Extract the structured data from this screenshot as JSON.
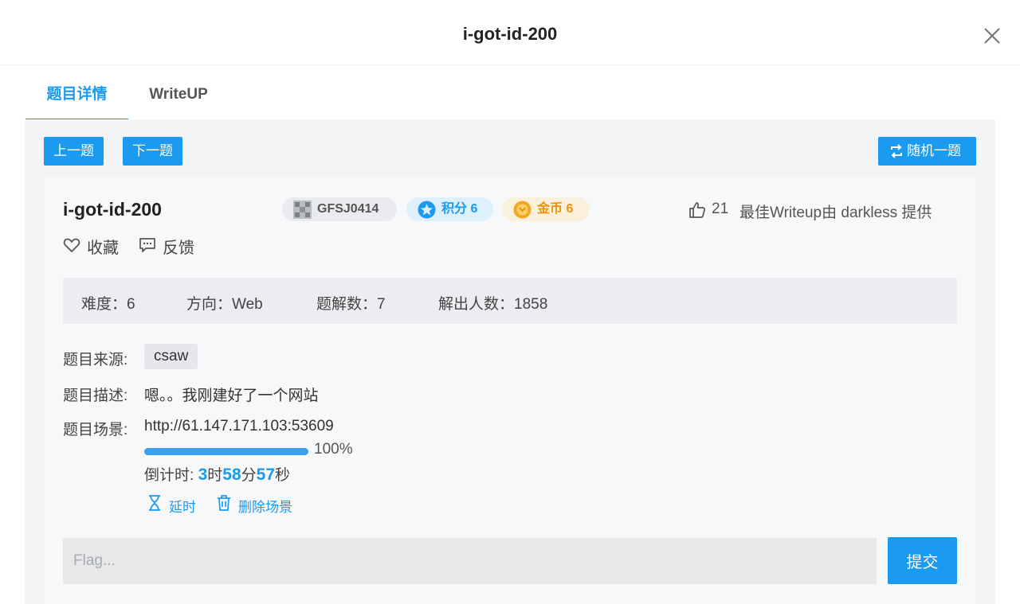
{
  "modal": {
    "title": "i-got-id-200"
  },
  "tabs": [
    {
      "label": "题目详情",
      "active": true
    },
    {
      "label": "WriteUP",
      "active": false
    }
  ],
  "toolbar": {
    "prev_label": "上一题",
    "next_label": "下一题",
    "random_label": "随机一题"
  },
  "challenge": {
    "name": "i-got-id-200",
    "author": "GFSJ0414",
    "score": "积分 6",
    "coins": "金币 6",
    "likes": "21",
    "best_writeup": "最佳Writeup由 darkless 提供",
    "favorite_label": "收藏",
    "feedback_label": "反馈"
  },
  "stats": {
    "difficulty": "难度：6",
    "direction": "方向：Web",
    "solutions": "题解数：7",
    "solvers": "解出人数：1858"
  },
  "details": {
    "source_label": "题目来源:",
    "source_value": "csaw",
    "desc_label": "题目描述:",
    "desc_value": "嗯。。我刚建好了一个网站",
    "scene_label": "题目场景:",
    "scene_url": "http://61.147.171.103:53609",
    "progress_percent": 100,
    "progress_text": "100%"
  },
  "countdown": {
    "prefix": "倒计时: ",
    "hours": "3",
    "hours_unit": "时",
    "minutes": "58",
    "minutes_unit": "分",
    "seconds": "57",
    "seconds_unit": "秒"
  },
  "scene_actions": {
    "extend_label": "延时",
    "delete_label": "删除场景"
  },
  "flag": {
    "placeholder": "Flag...",
    "submit_label": "提交"
  },
  "colors": {
    "accent": "#1a9bf0",
    "coin": "#f0900c",
    "panel_bg": "#f3f4f6"
  },
  "icons": [
    "close-icon",
    "repeat-icon",
    "score-icon",
    "coin-icon",
    "author-avatar-icon",
    "thumbs-up-icon",
    "heart-icon",
    "feedback-icon",
    "hourglass-icon",
    "trash-icon"
  ]
}
